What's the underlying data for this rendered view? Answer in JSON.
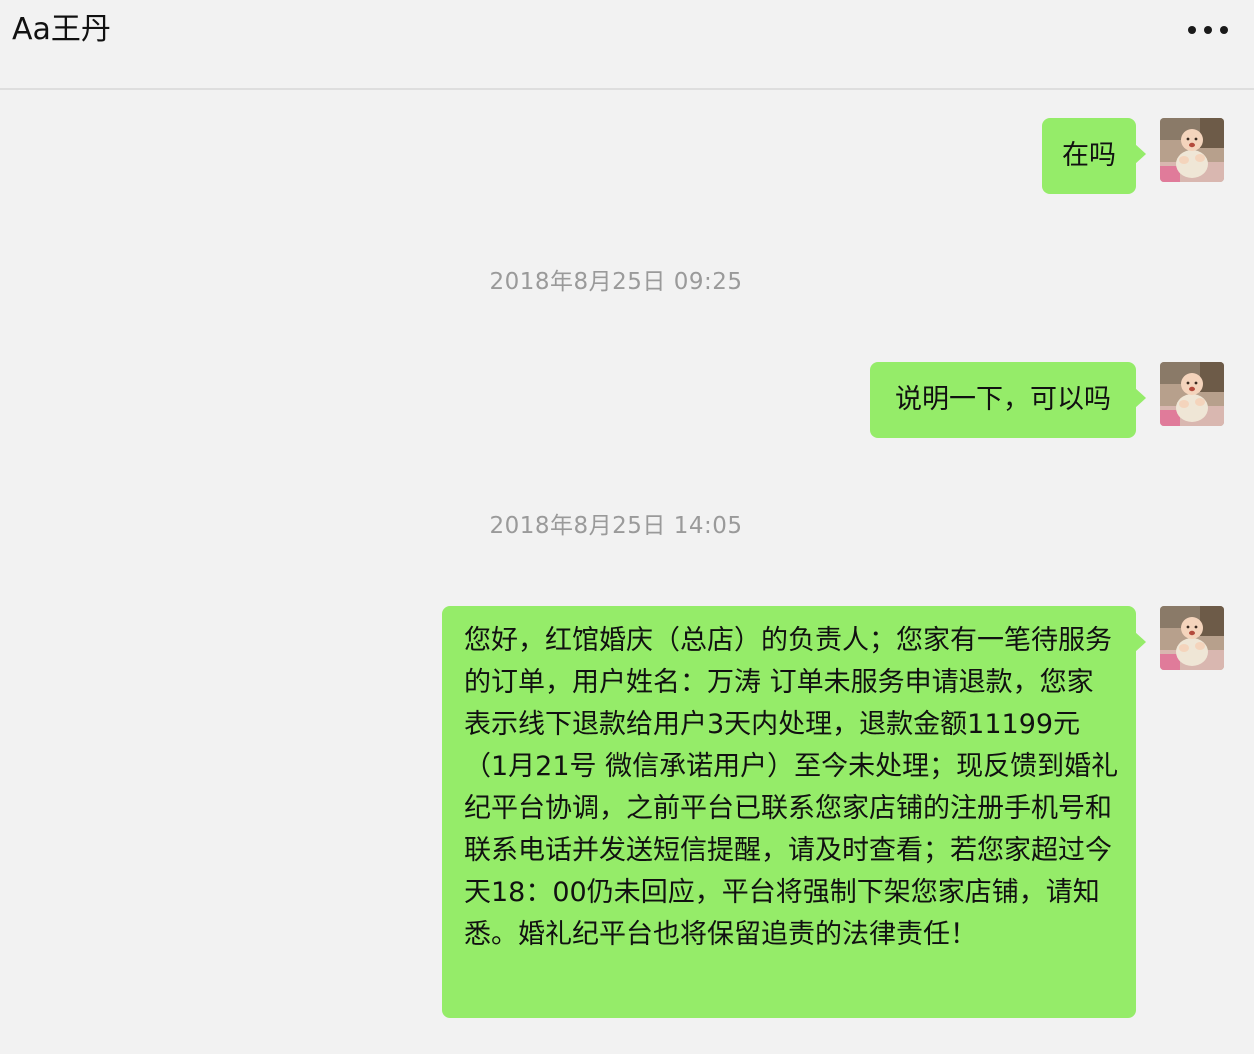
{
  "header": {
    "title": "Aa王丹",
    "more_icon": "more-dots-icon"
  },
  "messages": [
    {
      "type": "outgoing",
      "text": "在吗"
    },
    {
      "type": "timestamp",
      "text": "2018年8月25日 09:25"
    },
    {
      "type": "outgoing",
      "text": "说明一下，可以吗"
    },
    {
      "type": "timestamp",
      "text": "2018年8月25日 14:05"
    },
    {
      "type": "outgoing",
      "text": "您好，红馆婚庆（总店）的负责人；您家有一笔待服务的订单，用户姓名：万涛 订单未服务申请退款，您家表示线下退款给用户3天内处理，退款金额11199元（1月21号 微信承诺用户）至今未处理；现反馈到婚礼纪平台协调，之前平台已联系您家店铺的注册手机号和联系电话并发送短信提醒，请及时查看；若您家超过今天18：00仍未回应，平台将强制下架您家店铺，请知悉。婚礼纪平台也将保留追责的法律责任！"
    }
  ],
  "colors": {
    "background": "#f2f2f2",
    "bubble": "#95ec69",
    "timestamp": "#9a9a9a"
  }
}
